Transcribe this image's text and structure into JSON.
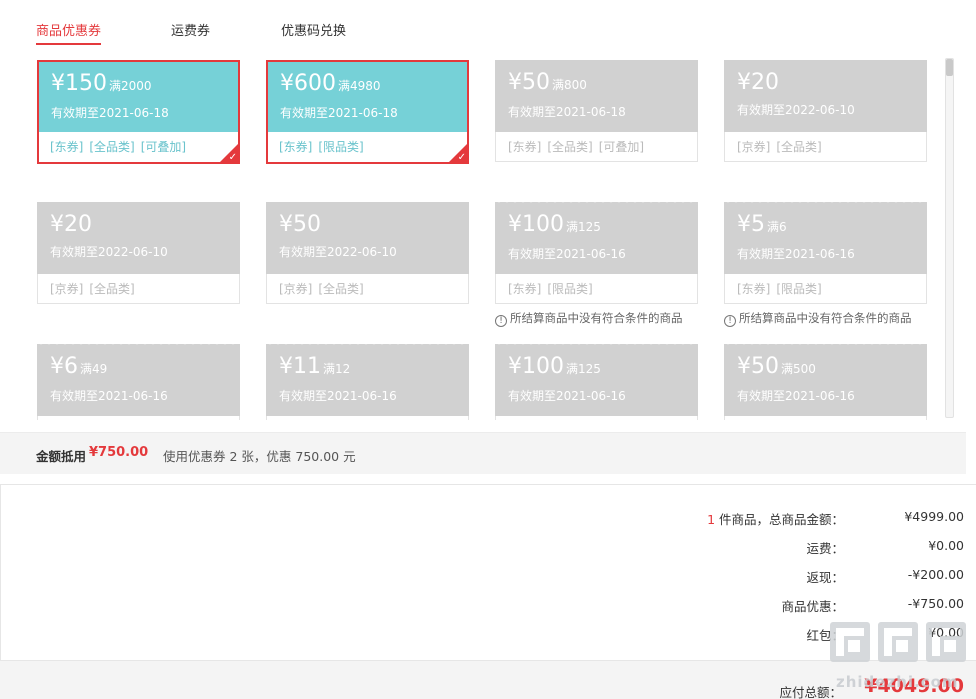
{
  "tabs": [
    "商品优惠券",
    "运费券",
    "优惠码兑换"
  ],
  "coupons": [
    {
      "amount": "¥150",
      "condition": "满2000",
      "validity": "有效期至2021-06-18",
      "tags": [
        "[东券]",
        "[全品类]",
        "[可叠加]"
      ],
      "selected": true
    },
    {
      "amount": "¥600",
      "condition": "满4980",
      "validity": "有效期至2021-06-18",
      "tags": [
        "[东券]",
        "[限品类]"
      ],
      "selected": true
    },
    {
      "amount": "¥50",
      "condition": "满800",
      "validity": "有效期至2021-06-18",
      "tags": [
        "[东券]",
        "[全品类]",
        "[可叠加]"
      ]
    },
    {
      "amount": "¥20",
      "condition": "",
      "validity": "有效期至2022-06-10",
      "tags": [
        "[京券]",
        "[全品类]"
      ]
    },
    {
      "amount": "¥20",
      "condition": "",
      "validity": "有效期至2022-06-10",
      "tags": [
        "[京券]",
        "[全品类]"
      ]
    },
    {
      "amount": "¥50",
      "condition": "",
      "validity": "有效期至2022-06-10",
      "tags": [
        "[京券]",
        "[全品类]"
      ]
    },
    {
      "amount": "¥100",
      "condition": "满125",
      "validity": "有效期至2021-06-16",
      "tags": [
        "[东券]",
        "[限品类]"
      ],
      "warning": "所结算商品中没有符合条件的商品"
    },
    {
      "amount": "¥5",
      "condition": "满6",
      "validity": "有效期至2021-06-16",
      "tags": [
        "[东券]",
        "[限品类]"
      ],
      "warning": "所结算商品中没有符合条件的商品"
    },
    {
      "amount": "¥6",
      "condition": "满49",
      "validity": "有效期至2021-06-16",
      "tags": []
    },
    {
      "amount": "¥11",
      "condition": "满12",
      "validity": "有效期至2021-06-16",
      "tags": []
    },
    {
      "amount": "¥100",
      "condition": "满125",
      "validity": "有效期至2021-06-16",
      "tags": []
    },
    {
      "amount": "¥50",
      "condition": "满500",
      "validity": "有效期至2021-06-16",
      "tags": []
    }
  ],
  "summary": {
    "label": "金额抵用",
    "amount": "¥750.00",
    "note": "使用优惠券 2 张，优惠 750.00 元"
  },
  "totals": {
    "count": "1",
    "goods_label": " 件商品，总商品金额：",
    "goods_value": "¥4999.00",
    "rows": [
      {
        "label": "运费：",
        "value": "¥0.00"
      },
      {
        "label": "返现：",
        "value": "-¥200.00"
      },
      {
        "label": "商品优惠：",
        "value": "-¥750.00"
      },
      {
        "label": "红包：",
        "value": "¥0.00"
      }
    ]
  },
  "pay": {
    "label": "应付总额：",
    "value": "¥4049.00"
  },
  "watermark": "zhidezhi.com",
  "colors": {
    "accent": "#e4393c",
    "selected_coupon": "#76d1d7",
    "disabled_coupon": "#d1d1d1"
  }
}
